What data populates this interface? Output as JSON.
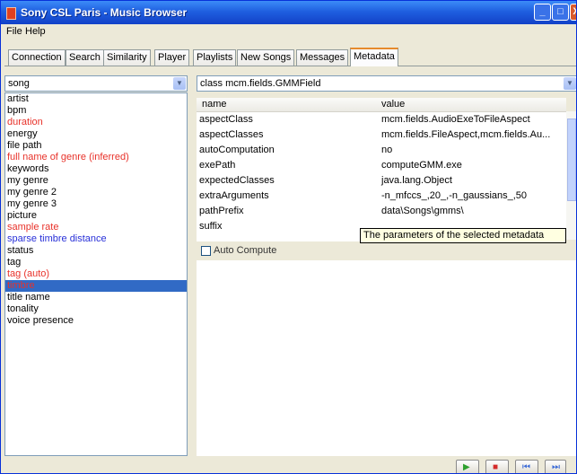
{
  "window": {
    "title": "Sony CSL Paris - Music Browser",
    "min_label": "_",
    "max_label": "□",
    "close_label": "X"
  },
  "menu": {
    "file": "File",
    "help": "Help"
  },
  "tabs": [
    {
      "label": "Connection"
    },
    {
      "label": "Search"
    },
    {
      "label": "Similarity"
    },
    {
      "label": "Player"
    },
    {
      "label": "Playlists"
    },
    {
      "label": "New Songs"
    },
    {
      "label": "Messages"
    },
    {
      "label": "Metadata",
      "active": true
    }
  ],
  "left_combo": {
    "value": "song"
  },
  "right_combo": {
    "value": "class mcm.fields.GMMField"
  },
  "fields": [
    {
      "label": "artist",
      "color": "black"
    },
    {
      "label": "bpm",
      "color": "black"
    },
    {
      "label": "duration",
      "color": "red"
    },
    {
      "label": "energy",
      "color": "black"
    },
    {
      "label": "file path",
      "color": "black"
    },
    {
      "label": "full name of genre (inferred)",
      "color": "red"
    },
    {
      "label": "keywords",
      "color": "black"
    },
    {
      "label": "my genre",
      "color": "black"
    },
    {
      "label": "my genre 2",
      "color": "black"
    },
    {
      "label": "my genre 3",
      "color": "black"
    },
    {
      "label": "picture",
      "color": "black"
    },
    {
      "label": "sample rate",
      "color": "red"
    },
    {
      "label": "sparse timbre distance",
      "color": "blue"
    },
    {
      "label": "status",
      "color": "black"
    },
    {
      "label": "tag",
      "color": "black"
    },
    {
      "label": "tag (auto)",
      "color": "red"
    },
    {
      "label": "timbre",
      "color": "red",
      "selected": true
    },
    {
      "label": "title name",
      "color": "black"
    },
    {
      "label": "tonality",
      "color": "black"
    },
    {
      "label": "voice presence",
      "color": "black"
    }
  ],
  "table": {
    "headers": {
      "name": "name",
      "value": "value"
    },
    "rows": [
      {
        "name": "aspectClass",
        "value": "mcm.fields.AudioExeToFileAspect"
      },
      {
        "name": "aspectClasses",
        "value": "mcm.fields.FileAspect,mcm.fields.Au..."
      },
      {
        "name": "autoComputation",
        "value": "no"
      },
      {
        "name": "exePath",
        "value": "computeGMM.exe"
      },
      {
        "name": "expectedClasses",
        "value": "java.lang.Object"
      },
      {
        "name": "extraArguments",
        "value": "-n_mfccs_,20_,-n_gaussians_,50"
      },
      {
        "name": "pathPrefix",
        "value": "data\\Songs\\gmms\\"
      },
      {
        "name": "suffix",
        "value": ""
      }
    ]
  },
  "tooltip": {
    "text": "The parameters of the selected metadata"
  },
  "auto_compute": {
    "label": "Auto Compute",
    "checked": false
  },
  "controls": [
    {
      "name": "play",
      "glyph": "▶",
      "color": "#2ea02e"
    },
    {
      "name": "stop",
      "glyph": "■",
      "color": "#d42a2a"
    },
    {
      "name": "previous",
      "glyph": "⏮",
      "color": "#3a6ad8"
    },
    {
      "name": "next",
      "glyph": "⏭",
      "color": "#3a6ad8"
    }
  ]
}
